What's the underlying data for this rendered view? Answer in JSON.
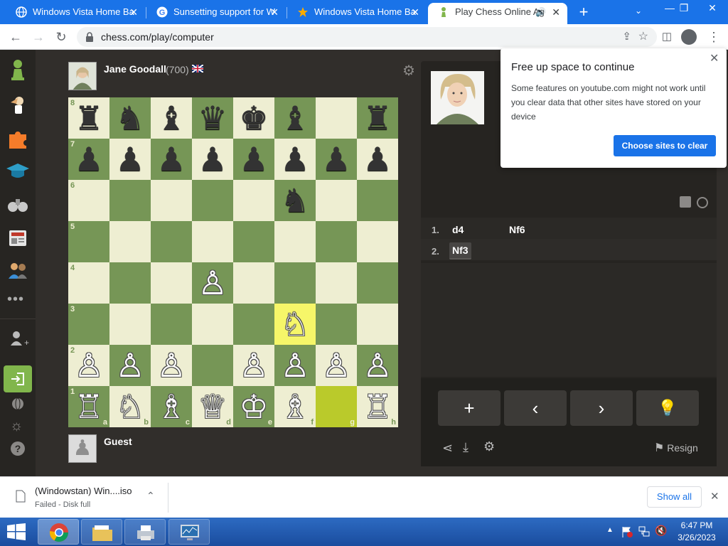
{
  "tabs": [
    {
      "title": "Windows Vista Home Ba"
    },
    {
      "title": "Sunsetting support for W"
    },
    {
      "title": "Windows Vista Home Ba"
    },
    {
      "title": "Play Chess Online Ag"
    }
  ],
  "address": {
    "url": "chess.com/play/computer"
  },
  "opponent": {
    "name": "Jane Goodall",
    "rating": "(700)"
  },
  "player": {
    "name": "Guest"
  },
  "board": {
    "rows": [
      [
        "♜",
        "♞",
        "♝",
        "♛",
        "♚",
        "♝",
        "",
        "♜"
      ],
      [
        "♟",
        "♟",
        "♟",
        "♟",
        "♟",
        "♟",
        "♟",
        "♟"
      ],
      [
        "",
        "",
        "",
        "",
        "",
        "♞",
        "",
        ""
      ],
      [
        "",
        "",
        "",
        "",
        "",
        "",
        "",
        ""
      ],
      [
        "",
        "",
        "",
        "♙",
        "",
        "",
        "",
        ""
      ],
      [
        "",
        "",
        "",
        "",
        "",
        "♘",
        "",
        ""
      ],
      [
        "♙",
        "♙",
        "♙",
        "",
        "♙",
        "♙",
        "♙",
        "♙"
      ],
      [
        "♖",
        "♘",
        "♗",
        "♕",
        "♔",
        "♗",
        "",
        "♖"
      ]
    ],
    "ranks": [
      "8",
      "7",
      "6",
      "5",
      "4",
      "3",
      "2",
      "1"
    ],
    "files": [
      "a",
      "b",
      "c",
      "d",
      "e",
      "f",
      "g",
      "h"
    ],
    "highlight_from": "g1",
    "highlight_to": "f3"
  },
  "moves": [
    {
      "num": "1.",
      "white": "d4",
      "black": "Nf6"
    },
    {
      "num": "2.",
      "white": "Nf3",
      "black": ""
    }
  ],
  "controls": {
    "resign": "Resign"
  },
  "popup": {
    "title": "Free up space to continue",
    "body": "Some features on youtube.com might not work until you clear data that other sites have stored on your device",
    "button": "Choose sites to clear"
  },
  "download": {
    "file": "(Windowstan) Win....iso",
    "status": "Failed - Disk full",
    "show_all": "Show all"
  },
  "taskbar": {
    "time": "6:47 PM",
    "date": "3/26/2023"
  },
  "colors": {
    "chrome_blue": "#1a73e8",
    "board_light": "#eeeed2",
    "board_dark": "#769656",
    "sidebar_green": "#81b64c"
  }
}
